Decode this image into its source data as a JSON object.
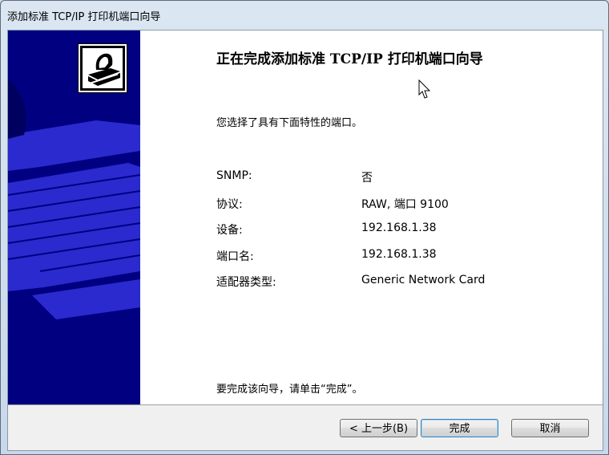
{
  "window": {
    "title": "添加标准 TCP/IP 打印机端口向导"
  },
  "wizard": {
    "heading": "正在完成添加标准 TCP/IP 打印机端口向导",
    "intro": "您选择了具有下面特性的端口。",
    "properties": [
      {
        "label": "SNMP:",
        "value": "否"
      },
      {
        "label": "协议:",
        "value": "RAW, 端口 9100"
      },
      {
        "label": "设备:",
        "value": "192.168.1.38"
      },
      {
        "label": "端口名:",
        "value": "192.168.1.38"
      },
      {
        "label": "适配器类型:",
        "value": "Generic Network Card"
      }
    ],
    "finish_note": "要完成该向导，请单击“完成”。"
  },
  "buttons": {
    "back": "< 上一步(B)",
    "finish": "完成",
    "cancel": "取消"
  },
  "colors": {
    "side_panel": "#000080",
    "dialog_bg": "#f0f0f0"
  },
  "icons": [
    "printer-logo-icon",
    "mouse-cursor-icon"
  ]
}
